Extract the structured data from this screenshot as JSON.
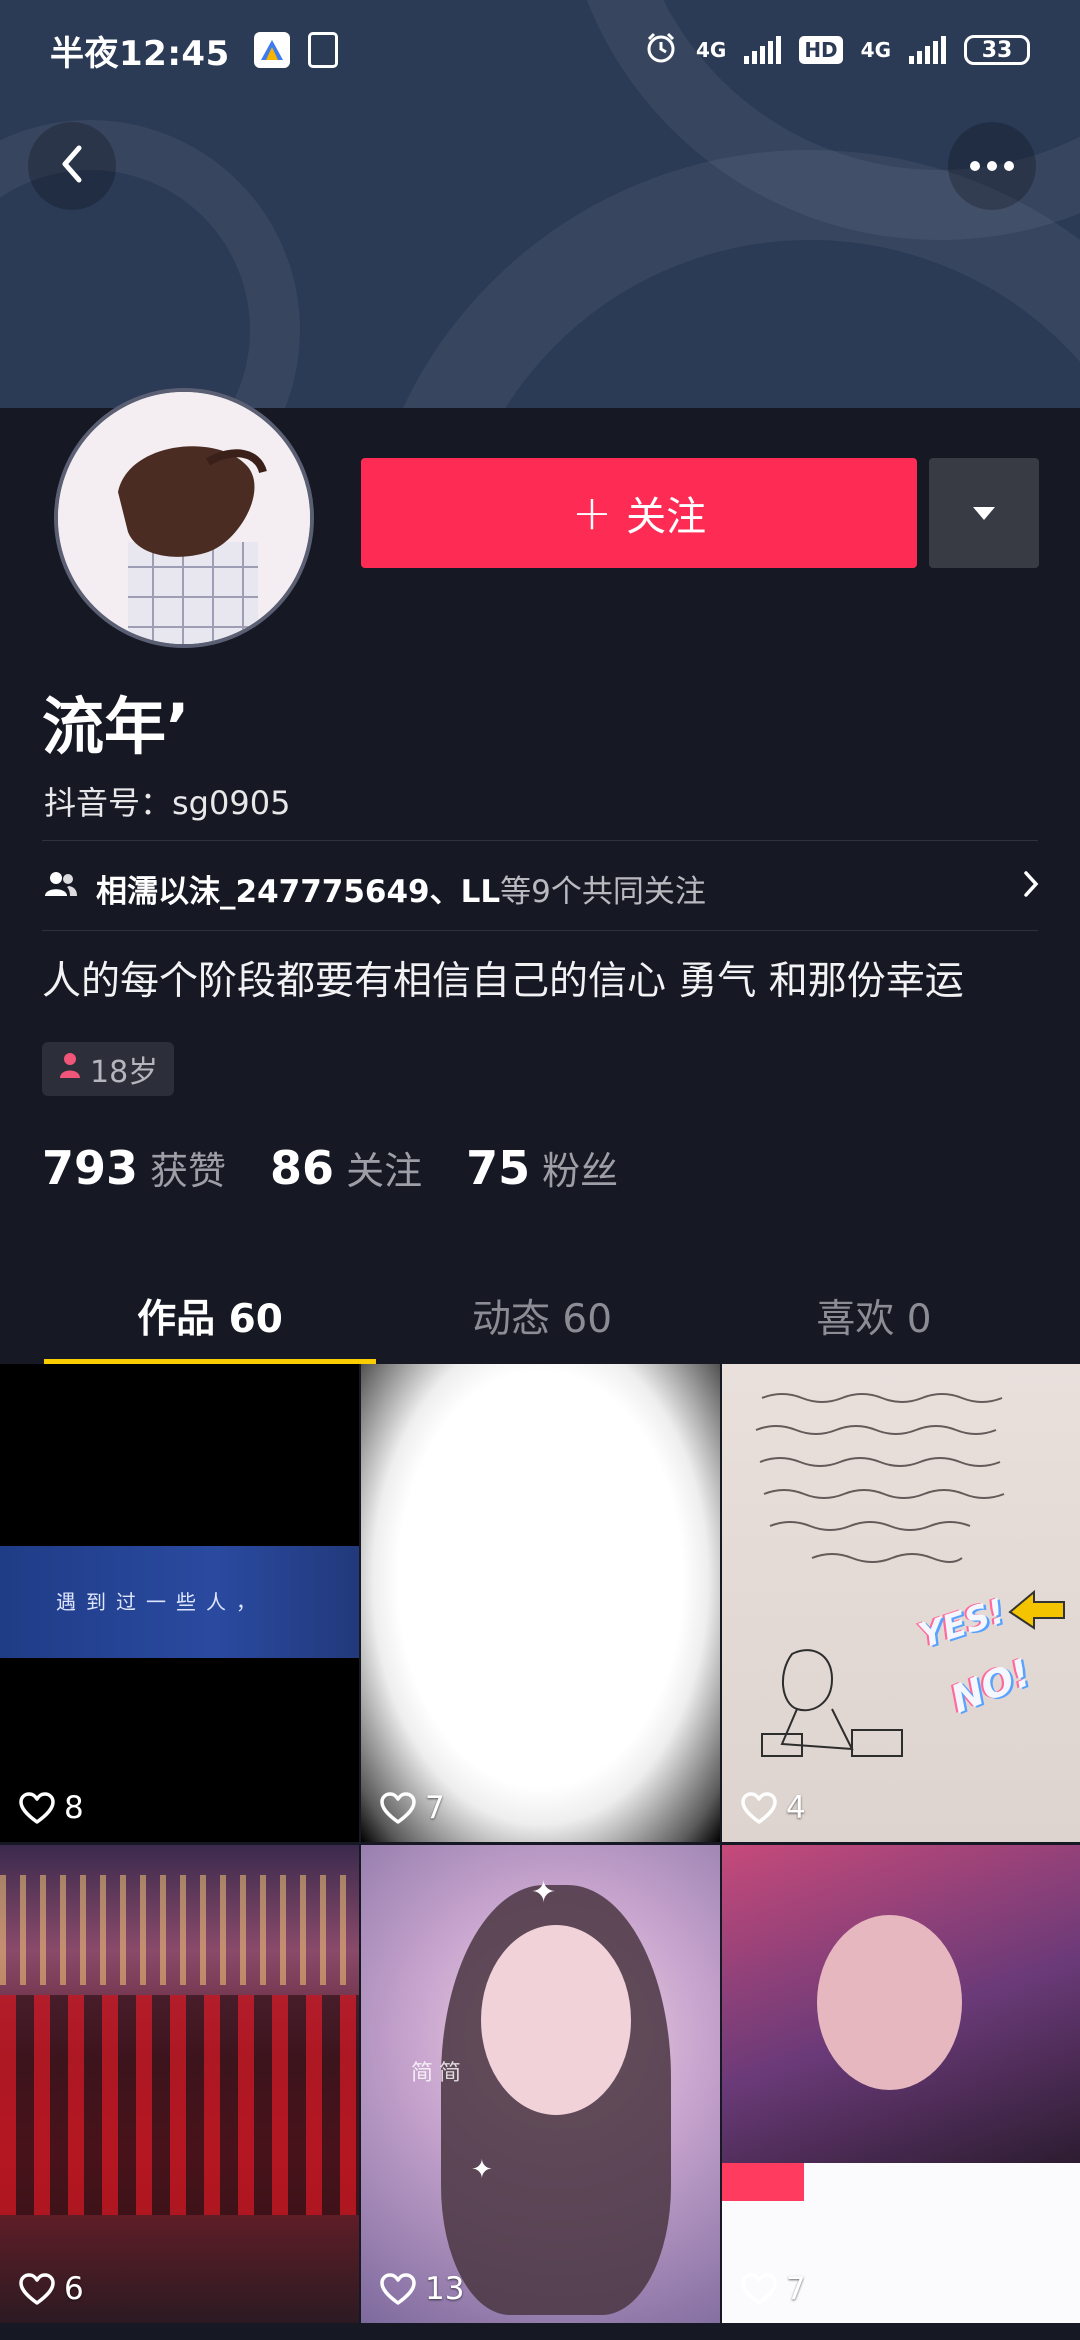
{
  "status_bar": {
    "time": "半夜12:45",
    "network_1": "4G",
    "hd": "HD",
    "network_2": "4G",
    "battery": "33"
  },
  "profile": {
    "follow_label": "关注",
    "nickname": "流年’",
    "douyin_id": "抖音号：sg0905",
    "mutual_names": "相濡以沫_247775649、LL",
    "mutual_rest": "等9个共同关注",
    "bio": "人的每个阶段都要有相信自己的信心 勇气 和那份幸运",
    "age": "18岁"
  },
  "stats": [
    {
      "value": "793",
      "label": "获赞"
    },
    {
      "value": "86",
      "label": "关注"
    },
    {
      "value": "75",
      "label": "粉丝"
    }
  ],
  "tabs": [
    {
      "label": "作品 60",
      "active": true
    },
    {
      "label": "动态 60",
      "active": false
    },
    {
      "label": "喜欢 0",
      "active": false
    }
  ],
  "videos": [
    {
      "likes": "8",
      "caption": "遇到过一些人，"
    },
    {
      "likes": "7"
    },
    {
      "likes": "4",
      "yes": "YES!",
      "no": "NO!"
    },
    {
      "likes": "6"
    },
    {
      "likes": "13",
      "watermark": "简简"
    },
    {
      "likes": "7"
    }
  ],
  "colors": {
    "background": "#161823",
    "follow_button": "#fe2c55",
    "tab_indicator": "#facd00"
  }
}
